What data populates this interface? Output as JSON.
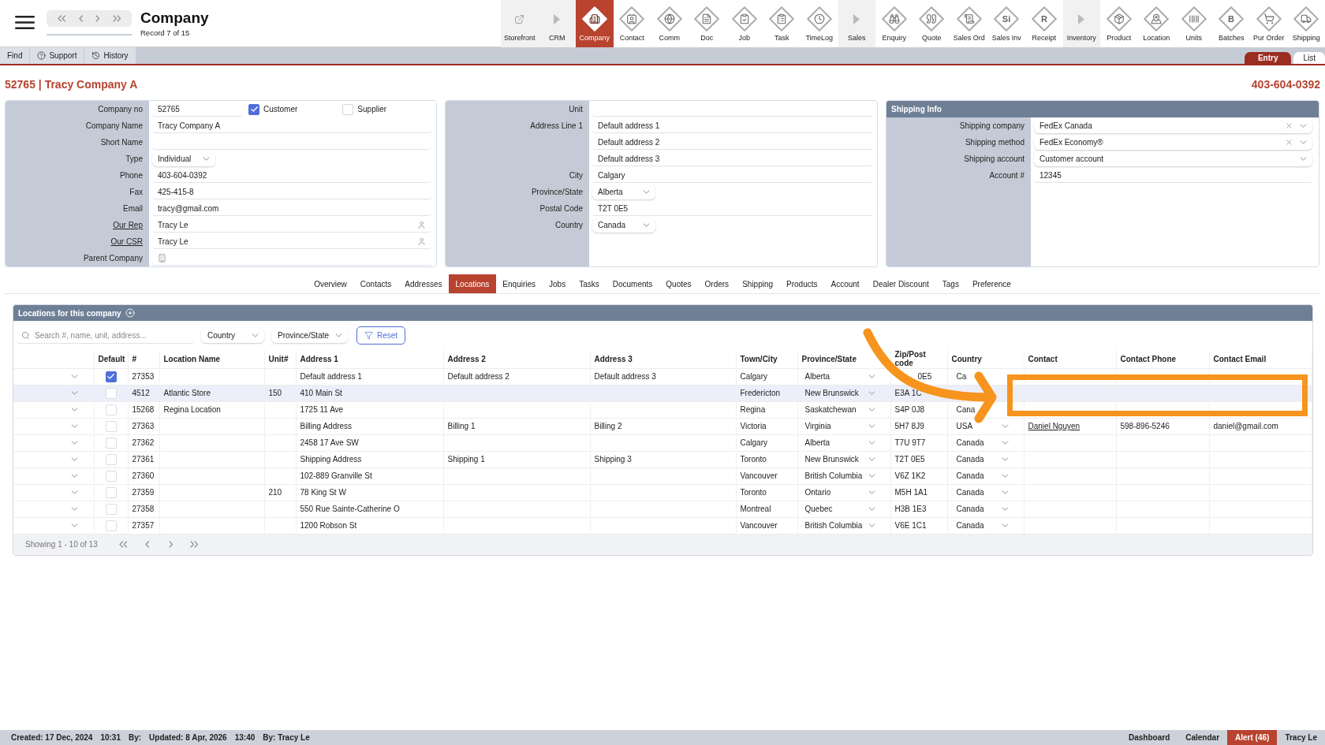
{
  "app_bar": {
    "title": "Company",
    "record_position": "Record 7 of 15",
    "modules": [
      {
        "label": "Storefront",
        "kind": "section",
        "selected": false
      },
      {
        "label": "CRM",
        "kind": "section",
        "selected": false
      },
      {
        "label": "Company",
        "kind": "module",
        "selected": true
      },
      {
        "label": "Contact",
        "kind": "module",
        "selected": false
      },
      {
        "label": "Comm",
        "kind": "module",
        "selected": false
      },
      {
        "label": "Doc",
        "kind": "module",
        "selected": false
      },
      {
        "label": "Job",
        "kind": "module",
        "selected": false
      },
      {
        "label": "Task",
        "kind": "module",
        "selected": false
      },
      {
        "label": "TimeLog",
        "kind": "module",
        "selected": false
      },
      {
        "label": "Sales",
        "kind": "section",
        "selected": false
      },
      {
        "label": "Enquiry",
        "kind": "module",
        "selected": false
      },
      {
        "label": "Quote",
        "kind": "module",
        "selected": false
      },
      {
        "label": "Sales Ord",
        "kind": "module",
        "selected": false
      },
      {
        "label": "Sales Inv",
        "kind": "module",
        "selected": false,
        "glyph": "Si"
      },
      {
        "label": "Receipt",
        "kind": "module",
        "selected": false,
        "glyph": "R"
      },
      {
        "label": "Inventory",
        "kind": "section",
        "selected": false
      },
      {
        "label": "Product",
        "kind": "module",
        "selected": false
      },
      {
        "label": "Location",
        "kind": "module",
        "selected": false
      },
      {
        "label": "Units",
        "kind": "module",
        "selected": false
      },
      {
        "label": "Batches",
        "kind": "module",
        "selected": false,
        "glyph": "B"
      },
      {
        "label": "Pur Order",
        "kind": "module",
        "selected": false
      },
      {
        "label": "Shipping",
        "kind": "module",
        "selected": false
      }
    ]
  },
  "toolbar": {
    "buttons": [
      "Find",
      "Support",
      "History"
    ],
    "views": [
      {
        "label": "Entry",
        "selected": true
      },
      {
        "label": "List",
        "selected": false
      }
    ]
  },
  "record": {
    "title": "52765 | Tracy Company A",
    "phone": "403-604-0392"
  },
  "panels": [
    {
      "rows": [
        {
          "label": "Company no",
          "kind": "text",
          "value": "52765",
          "link": false,
          "checks": [
            {
              "label": "Customer",
              "checked": true
            },
            {
              "label": "Supplier",
              "checked": false
            }
          ]
        },
        {
          "label": "Company Name",
          "kind": "text",
          "value": "Tracy Company A",
          "link": false
        },
        {
          "label": "Short Name",
          "kind": "text",
          "link": false
        },
        {
          "label": "Type",
          "kind": "select",
          "value": "Individual",
          "link": false
        },
        {
          "label": "Phone",
          "kind": "text",
          "value": "403-604-0392",
          "link": false
        },
        {
          "label": "Fax",
          "kind": "text",
          "value": "425-415-8",
          "link": false
        },
        {
          "label": "Email",
          "kind": "text",
          "value": "tracy@gmail.com",
          "link": false
        },
        {
          "label": "Our Rep",
          "kind": "person",
          "value": "Tracy Le",
          "link": true
        },
        {
          "label": "Our CSR",
          "kind": "person",
          "value": "Tracy Le",
          "link": true
        },
        {
          "label": "Parent Company",
          "kind": "company",
          "link": false
        }
      ]
    },
    {
      "rows": [
        {
          "label": "Unit",
          "kind": "text"
        },
        {
          "label": "Address Line 1",
          "kind": "text",
          "value": "Default address 1"
        },
        {
          "kind": "text",
          "value": "Default address 2"
        },
        {
          "kind": "text",
          "value": "Default address 3"
        },
        {
          "label": "City",
          "kind": "text",
          "value": "Calgary"
        },
        {
          "label": "Province/State",
          "kind": "select",
          "value": "Alberta"
        },
        {
          "label": "Postal Code",
          "kind": "text",
          "value": "T2T 0E5"
        },
        {
          "label": "Country",
          "kind": "select",
          "value": "Canada"
        }
      ]
    },
    {
      "title": "Shipping Info",
      "rows": [
        {
          "label": "Shipping company",
          "kind": "combo",
          "value": "FedEx Canada",
          "clearable": true
        },
        {
          "label": "Shipping method",
          "kind": "combo",
          "value": "FedEx Economy®",
          "clearable": true
        },
        {
          "label": "Shipping account",
          "kind": "combo",
          "value": "Customer account",
          "clearable": false
        },
        {
          "label": "Account #",
          "kind": "text",
          "value": "12345"
        }
      ]
    }
  ],
  "tabs": [
    {
      "label": "Overview",
      "selected": false
    },
    {
      "label": "Contacts",
      "selected": false
    },
    {
      "label": "Addresses",
      "selected": false
    },
    {
      "label": "Locations",
      "selected": true
    },
    {
      "label": "Enquiries",
      "selected": false
    },
    {
      "label": "Jobs",
      "selected": false
    },
    {
      "label": "Tasks",
      "selected": false
    },
    {
      "label": "Documents",
      "selected": false
    },
    {
      "label": "Quotes",
      "selected": false
    },
    {
      "label": "Orders",
      "selected": false
    },
    {
      "label": "Shipping",
      "selected": false
    },
    {
      "label": "Products",
      "selected": false
    },
    {
      "label": "Account",
      "selected": false
    },
    {
      "label": "Dealer Discount",
      "selected": false
    },
    {
      "label": "Tags",
      "selected": false
    },
    {
      "label": "Preference",
      "selected": false
    }
  ],
  "locations": {
    "title": "Locations for this company",
    "search": {
      "placeholder": "Search #, name, unit, address..."
    },
    "filters": [
      "Country",
      "Province/State"
    ],
    "reset": "Reset",
    "columns": [
      "Default",
      "#",
      "Location Name",
      "Unit#",
      "Address 1",
      "Address 2",
      "Address 3",
      "Town/City",
      "Province/State",
      "Zip/Post code",
      "Country",
      "Contact",
      "Contact Phone",
      "Contact Email"
    ],
    "rows": [
      {
        "selected": false,
        "default": true,
        "number": "27353",
        "address_1": "Default address 1",
        "address_2": "Default address 2",
        "address_3": "Default address 3",
        "city": "Calgary",
        "province": "Alberta",
        "zip": "0E5",
        "zip_partly_hidden": true,
        "country": "Ca",
        "country_chevron": false
      },
      {
        "selected": true,
        "default": false,
        "number": "4512",
        "location_name": "Atlantic Store",
        "unit": "150",
        "address_1": "410 Main St",
        "city": "Fredericton",
        "province": "New Brunswick",
        "zip": "E3A 1C",
        "zip_partly_hidden": false,
        "country_chevron": false
      },
      {
        "selected": false,
        "default": false,
        "number": "15268",
        "location_name": "Regina Location",
        "address_1": "1725 11 Ave",
        "city": "Regina",
        "province": "Saskatchewan",
        "zip": "S4P 0J8",
        "zip_partly_hidden": false,
        "country": "Cana",
        "country_chevron": false
      },
      {
        "selected": false,
        "default": false,
        "number": "27363",
        "address_1": "Billing Address",
        "address_2": "Billing 1",
        "address_3": "Billing 2",
        "city": "Victoria",
        "province": "Virginia",
        "zip": "5H7 8J9",
        "zip_partly_hidden": false,
        "country": "USA",
        "country_chevron": true,
        "contact": "Daniel Nguyen",
        "contact_phone": "598-896-5246",
        "contact_email": "daniel@gmail.com"
      },
      {
        "selected": false,
        "default": false,
        "number": "27362",
        "address_1": "2458 17 Ave SW",
        "city": "Calgary",
        "province": "Alberta",
        "zip": "T7U 9T7",
        "zip_partly_hidden": false,
        "country": "Canada",
        "country_chevron": true
      },
      {
        "selected": false,
        "default": false,
        "number": "27361",
        "address_1": "Shipping Address",
        "address_2": "Shipping 1",
        "address_3": "Shipping 3",
        "city": "Toronto",
        "province": "New Brunswick",
        "zip": "T2T 0E5",
        "zip_partly_hidden": false,
        "country": "Canada",
        "country_chevron": true
      },
      {
        "selected": false,
        "default": false,
        "number": "27360",
        "address_1": "102-889 Granville St",
        "city": "Vancouver",
        "province": "British Columbia",
        "zip": "V6Z 1K2",
        "zip_partly_hidden": false,
        "country": "Canada",
        "country_chevron": true
      },
      {
        "selected": false,
        "default": false,
        "number": "27359",
        "unit": "210",
        "address_1": "78 King St W",
        "city": "Toronto",
        "province": "Ontario",
        "zip": "M5H 1A1",
        "zip_partly_hidden": false,
        "country": "Canada",
        "country_chevron": true
      },
      {
        "selected": false,
        "default": false,
        "number": "27358",
        "address_1": "550 Rue Sainte-Catherine O",
        "city": "Montreal",
        "province": "Quebec",
        "zip": "H3B 1E3",
        "zip_partly_hidden": false,
        "country": "Canada",
        "country_chevron": true
      },
      {
        "selected": false,
        "default": false,
        "number": "27357",
        "address_1": "1200 Robson St",
        "city": "Vancouver",
        "province": "British Columbia",
        "zip": "V6E 1C1",
        "zip_partly_hidden": false,
        "country": "Canada",
        "country_chevron": true
      }
    ],
    "footer": "Showing 1 - 10 of 13"
  },
  "status_bar": {
    "left": [
      "Created: 17 Dec, 2024",
      "10:31",
      "By:",
      "Updated: 8 Apr, 2026",
      "13:40",
      "By: Tracy Le"
    ],
    "right": [
      {
        "label": "Dashboard",
        "kind": "link"
      },
      {
        "label": "Calendar",
        "kind": "link"
      },
      {
        "label": "Alert (46)",
        "kind": "alert"
      },
      {
        "label": "Tracy Le",
        "kind": "link"
      }
    ]
  },
  "annotations": {
    "arrow": true,
    "frame": true
  }
}
